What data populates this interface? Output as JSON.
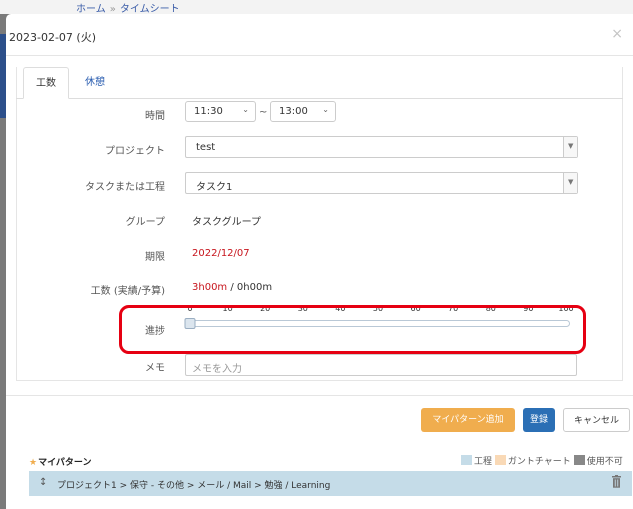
{
  "background": {
    "breadcrumb": [
      "ホーム",
      "タイムシート"
    ],
    "breadcrumb_sep": "»"
  },
  "modal": {
    "title": "2023-02-07 (火)",
    "close_icon": "close-icon"
  },
  "tabs": [
    {
      "label": "工数",
      "active": true
    },
    {
      "label": "休憩",
      "active": false
    }
  ],
  "form": {
    "time": {
      "label": "時間",
      "start": "11:30",
      "separator": "~",
      "end": "13:00"
    },
    "project": {
      "label": "プロジェクト",
      "value": "test"
    },
    "task": {
      "label": "タスクまたは工程",
      "value": "タスク1"
    },
    "group": {
      "label": "グループ",
      "value": "タスクグループ"
    },
    "deadline": {
      "label": "期限",
      "value": "2022/12/07",
      "color": "#c7151d"
    },
    "effort": {
      "label": "工数 (実績/予算)",
      "actual": "3h00m",
      "separator": " / ",
      "budget": "0h00m"
    },
    "progress": {
      "label": "進捗",
      "ticks": [
        "0",
        "10",
        "20",
        "30",
        "40",
        "50",
        "60",
        "70",
        "80",
        "90",
        "100"
      ],
      "value": 0
    },
    "memo": {
      "label": "メモ",
      "placeholder": "メモを入力",
      "value": ""
    }
  },
  "buttons": {
    "add_pattern": "マイパターン追加",
    "register": "登録",
    "cancel": "キャンセル"
  },
  "my_patterns": {
    "star_icon": "★",
    "title": "マイパターン",
    "legend": [
      {
        "label": "工程",
        "color": "#c5dce8"
      },
      {
        "label": "ガントチャート",
        "color": "#f9d9b6"
      },
      {
        "label": "使用不可",
        "color": "#888888"
      }
    ],
    "rows": [
      {
        "drag_icon": "↕",
        "path": "プロジェクト1 > 保守 - その他 > メール / Mail > 勉強 / Learning"
      }
    ]
  },
  "colors": {
    "orange": "#f0ad4e",
    "blue": "#2b6fb5",
    "highlight": "#e60012",
    "deadline_red": "#c7151d"
  }
}
